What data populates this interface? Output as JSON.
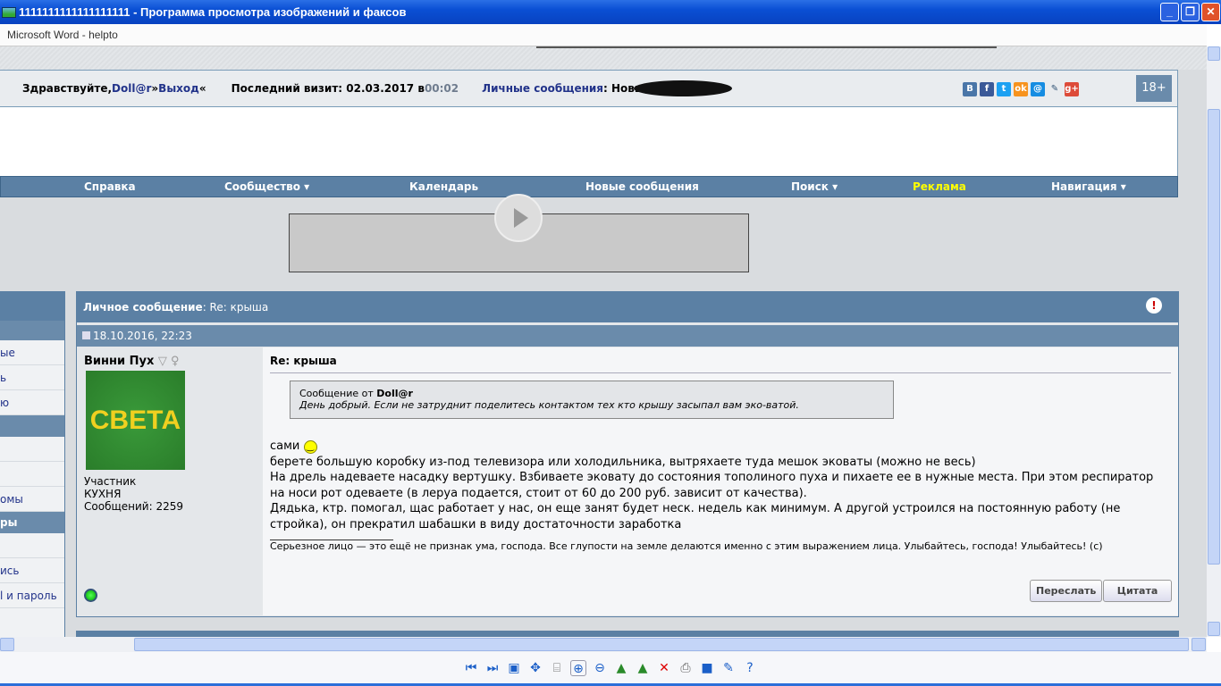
{
  "window": {
    "title": "1111111111111111111 - Программа просмотра изображений и факсов",
    "tab": "Microsoft Word - helpto"
  },
  "header": {
    "greeting": "Здравствуйте, ",
    "user": "Doll@r",
    "sep1": " » ",
    "logout": "Выход",
    "sep2": " «",
    "last_visit_label": "Последний визит: 02.03.2017 в ",
    "last_visit_time": "00:02",
    "pm_label": "Личные сообщения",
    "pm_value": ": Новые",
    "age": "18+",
    "social": [
      "В",
      "f",
      "t",
      "ok",
      "@",
      "✎",
      "g+"
    ]
  },
  "nav": [
    "Справка",
    "Сообщество ▾",
    "Календарь",
    "Новые сообщения",
    "Поиск ▾",
    "Реклама",
    "Навигация ▾"
  ],
  "sidebar": [
    "ые",
    "ь",
    "ю",
    "",
    "",
    "",
    "омы",
    "ры",
    "",
    "ись",
    "l и пароль"
  ],
  "post": {
    "header_label": "Личное сообщение",
    "header_title": ": Re: крыша",
    "date": "18.10.2016, 22:23",
    "author": "Винни Пух",
    "avatar_text": "СВЕТА",
    "rank": "Участник",
    "group": "КУХНЯ",
    "posts": "Сообщений: 2259",
    "title": "Re: крыша",
    "quote_from": "Сообщение от ",
    "quote_author": "Doll@r",
    "quote_text": "День добрый. Если не затруднит поделитесь контактом тех кто крышу засыпал вам эко-ватой.",
    "lines": [
      "сами",
      "берете большую коробку из-под телевизора или холодильника, вытряхаете туда мешок эковаты (можно не весь)",
      "На дрель надеваете насадку вертушку. Взбиваете эковату до состояния тополиного пуха и пихаете ее в нужные места. При этом респиратор на носи рот одеваете (в леруа подается, стоит от 60 до 200 руб. зависит от качества).",
      "Дядька, ктр. помогал, щас работает у нас, он еще занят будет неск. недель как минимум. А другой устроился на постоянную работу (не стройка), он прекратил шабашки в виду достаточности заработка"
    ],
    "signature": "Серьезное лицо — это ещё не признак ума, господа. Все глупости на земле делаются именно с этим выражением лица. Улыбайтесь, господа! Улыбайтесь! (с)",
    "forward": "Переслать",
    "quote_btn": "Цитата"
  }
}
